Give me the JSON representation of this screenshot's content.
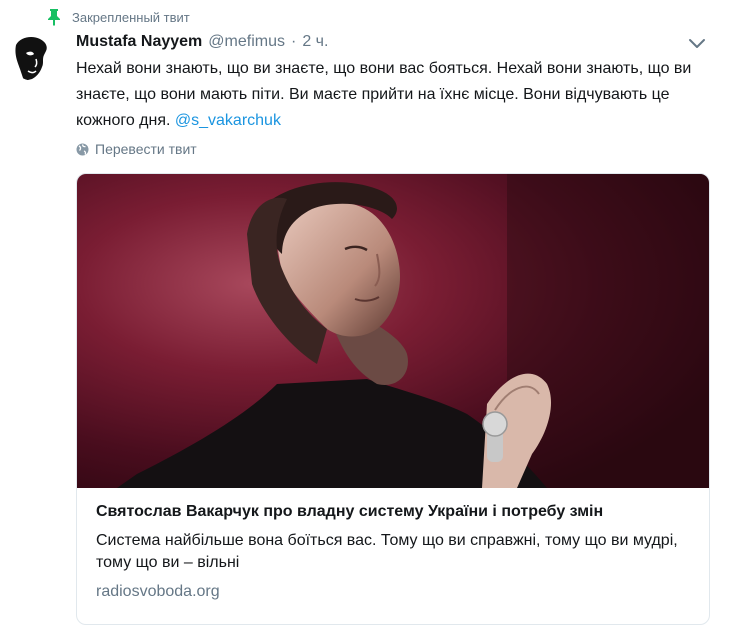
{
  "pinned": {
    "label": "Закрепленный твит",
    "icon": "pin-icon"
  },
  "tweet": {
    "author_name": "Mustafa Nayyem",
    "author_handle": "@mefimus",
    "separator": "·",
    "time": "2 ч.",
    "text_before_mention": "Нехай вони знають, що ви знаєте, що вони вас бояться. Нехай вони знають, що ви знаєте, що вони мають піти. Ви маєте прийти на їхнє місце. Вони відчувають це кожного дня. ",
    "mention": "@s_vakarchuk",
    "translate_label": "Перевести твит"
  },
  "card": {
    "title": "Святослав Вакарчук про владну систему України і потребу змін",
    "description": "Система найбільше вона боїться вас. Тому що ви справжні, тому що ви мудрі, тому що ви – вільні",
    "domain": "radiosvoboda.org"
  },
  "colors": {
    "pin": "#17bf63",
    "link": "#1b95e0",
    "secondary_text": "#657786",
    "primary_text": "#14171a",
    "card_border": "#e1e8ed"
  }
}
